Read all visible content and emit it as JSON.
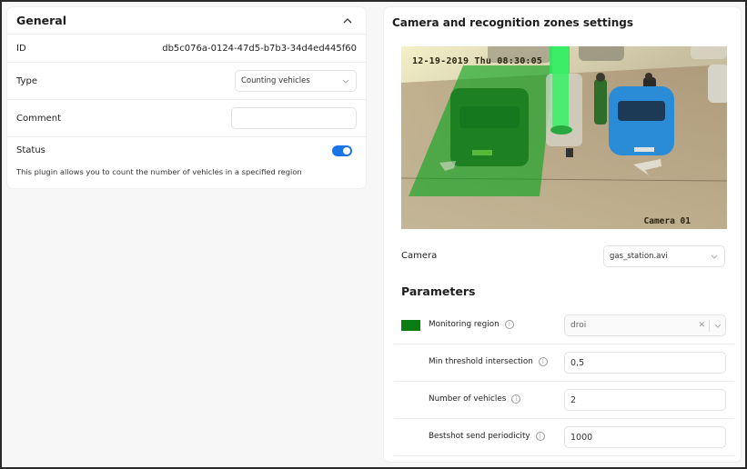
{
  "general": {
    "title": "General",
    "collapse_icon": "chevron-up-icon",
    "fields": {
      "id_label": "ID",
      "id_value": "db5c076a-0124-47d5-b7b3-34d4ed445f60",
      "type_label": "Type",
      "type_value": "Counting vehicles",
      "comment_label": "Comment",
      "comment_value": "",
      "comment_placeholder": "",
      "status_label": "Status",
      "status_on": true
    },
    "description": "This plugin allows you to count the number of vehicles in a specified region"
  },
  "camera_settings": {
    "title": "Camera and recognition zones settings",
    "preview": {
      "timestamp_overlay": "12-19-2019 Thu 08:30:05",
      "camera_overlay": "Camera 01",
      "zone_color": "#0a9a1a"
    },
    "camera_label": "Camera",
    "camera_value": "gas_station.avi"
  },
  "parameters": {
    "title": "Parameters",
    "items": [
      {
        "label": "Monitoring region",
        "value": "droi",
        "kind": "select",
        "swatch_color": "#0a7d12"
      },
      {
        "label": "Min threshold intersection",
        "value": "0,5",
        "kind": "input"
      },
      {
        "label": "Number of vehicles",
        "value": "2",
        "kind": "input"
      },
      {
        "label": "Bestshot send periodicity",
        "value": "1000",
        "kind": "input"
      }
    ]
  },
  "colors": {
    "accent": "#1a73e8",
    "zone": "#0a7d12",
    "background": "#f7f7f7",
    "card": "#ffffff"
  }
}
